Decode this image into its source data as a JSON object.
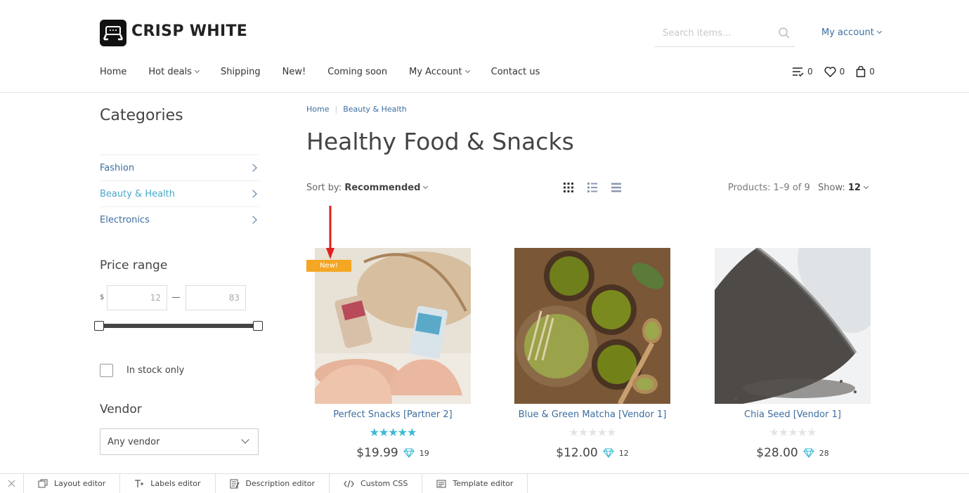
{
  "header": {
    "logo_text": "CRISP WHITE",
    "search_placeholder": "Search items...",
    "account_link": "My account",
    "nav": [
      {
        "label": "Home"
      },
      {
        "label": "Hot deals"
      },
      {
        "label": "Shipping"
      },
      {
        "label": "New!"
      },
      {
        "label": "Coming soon"
      },
      {
        "label": "My Account"
      },
      {
        "label": "Contact us"
      }
    ],
    "compare_count": "0",
    "wishlist_count": "0",
    "cart_count": "0"
  },
  "sidebar": {
    "categories_title": "Categories",
    "categories": [
      {
        "label": "Fashion"
      },
      {
        "label": "Beauty & Health"
      },
      {
        "label": "Electronics"
      }
    ],
    "price_title": "Price range",
    "currency": "$",
    "price_min": "12",
    "price_max": "83",
    "price_separator": "—",
    "in_stock_label": "In stock only",
    "vendor_title": "Vendor",
    "vendor_value": "Any vendor"
  },
  "main": {
    "breadcrumb": [
      "Home",
      "Beauty & Health"
    ],
    "title": "Healthy Food & Snacks",
    "sort_label": "Sort by:",
    "sort_value": "Recommended",
    "count_text": "Products: 1–9 of 9",
    "show_label": "Show:",
    "show_value": "12",
    "badge_new": "New!",
    "products": [
      {
        "name": "Perfect Snacks [Partner 2]",
        "price": "$19.99",
        "points": "19",
        "rating": 5
      },
      {
        "name": "Blue & Green Matcha [Vendor 1]",
        "price": "$12.00",
        "points": "12",
        "rating": 0
      },
      {
        "name": "Chia Seed [Vendor 1]",
        "price": "$28.00",
        "points": "28",
        "rating": 0
      }
    ]
  },
  "editor_bar": {
    "tools": [
      {
        "label": "Layout editor",
        "icon": "layout-icon"
      },
      {
        "label": "Labels editor",
        "icon": "text-icon"
      },
      {
        "label": "Description editor",
        "icon": "description-icon"
      },
      {
        "label": "Custom CSS",
        "icon": "code-icon"
      },
      {
        "label": "Template editor",
        "icon": "template-icon"
      }
    ]
  },
  "colors": {
    "link": "#3d6d9f",
    "active": "#4aa8c7",
    "star": "#3bbad6",
    "badge": "#f5a623",
    "arrow": "#e02020"
  }
}
